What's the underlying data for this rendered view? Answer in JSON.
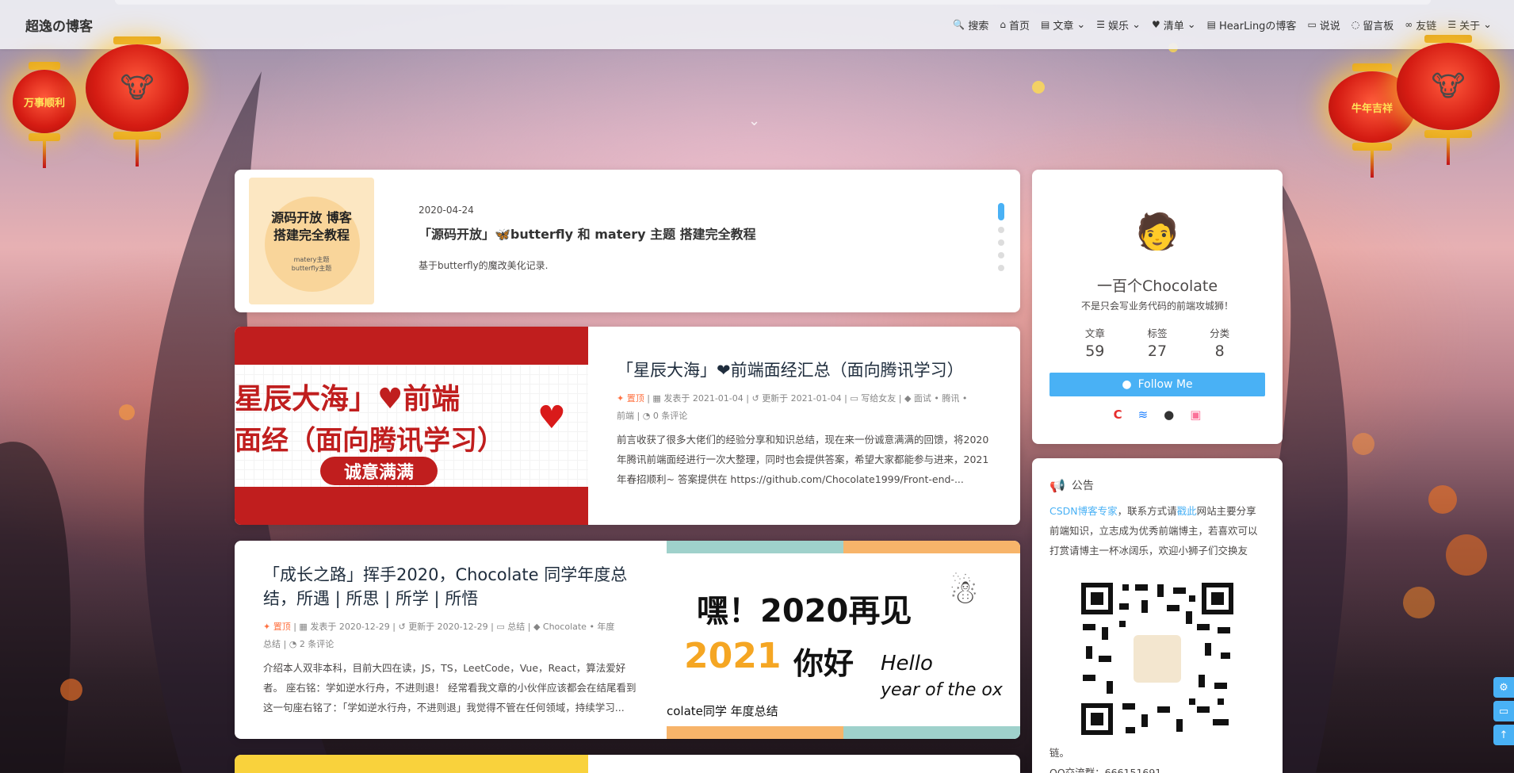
{
  "nav": {
    "brand": "超逸の博客",
    "items": [
      {
        "label": "搜索",
        "icon": "search-icon",
        "glyph": "🔍",
        "caret": false
      },
      {
        "label": "首页",
        "icon": "home-icon",
        "glyph": "⌂",
        "caret": false
      },
      {
        "label": "文章",
        "icon": "book-icon",
        "glyph": "▤",
        "caret": true
      },
      {
        "label": "娱乐",
        "icon": "list-icon",
        "glyph": "☰",
        "caret": true
      },
      {
        "label": "清单",
        "icon": "heart-icon",
        "glyph": "♥",
        "caret": true
      },
      {
        "label": "HearLingの博客",
        "icon": "book-icon",
        "glyph": "▤",
        "caret": false
      },
      {
        "label": "说说",
        "icon": "comment-icon",
        "glyph": "▭",
        "caret": false
      },
      {
        "label": "留言板",
        "icon": "message-icon",
        "glyph": "◌",
        "caret": false
      },
      {
        "label": "友链",
        "icon": "link-icon",
        "glyph": "∞",
        "caret": false
      },
      {
        "label": "关于",
        "icon": "list-icon",
        "glyph": "☰",
        "caret": true
      }
    ]
  },
  "lanterns": {
    "left": "万事顺利",
    "right": "牛年吉祥"
  },
  "slider": {
    "date": "2020-04-24",
    "title": "「源码开放」🦋butterfly 和 matery 主题 搭建完全教程",
    "desc": "基于butterfly的魔改美化记录.",
    "cover_line1": "源码开放 博客",
    "cover_line2": "搭建完全教程",
    "cover_sub1": "matery主题",
    "cover_sub2": "butterfly主题"
  },
  "posts": [
    {
      "title": "「星辰大海」❤前端面经汇总（面向腾讯学习）",
      "sticky": "置顶",
      "published": "发表于 2021-01-04",
      "updated": "更新于 2021-01-04",
      "category": "写给女友",
      "tags": "面试 • 腾讯 •",
      "tags2": "前端",
      "comments": "0 条评论",
      "excerpt": "前言收获了很多大佬们的经验分享和知识总结，现在来一份诚意满满的回馈，将2020年腾讯前端面经进行一次大整理，同时也会提供答案，希望大家都能参与进来，2021年春招顺利~ 答案提供在 https://github.com/Chocolate1999/Front-end-...",
      "cover_line1": "星辰大海」♥前端",
      "cover_line2": "面经（面向腾讯学习）",
      "cover_badge": "诚意满满"
    },
    {
      "title": "「成长之路」挥手2020，Chocolate 同学年度总结，所遇 | 所思 | 所学 | 所悟",
      "sticky": "置顶",
      "published": "发表于 2020-12-29",
      "updated": "更新于 2020-12-29",
      "category": "总结",
      "tags": "Chocolate • 年度",
      "tags2": "总结",
      "comments": "2 条评论",
      "excerpt": "介绍本人双非本科，目前大四在读，JS，TS，LeetCode，Vue，React，算法爱好者。 座右铭：学如逆水行舟，不进则退！ 经常看我文章的小伙伴应该都会在结尾看到这一句座右铭了：「学如逆水行舟，不进则退」我觉得不管在任何领域，持续学习...",
      "cover_line1": "嘿！2020再见",
      "cover_line2": "2021",
      "cover_line3": "你好",
      "cover_line4": "Hello",
      "cover_line5": "year of the ox",
      "cover_line6": "colate同学 年度总结"
    }
  ],
  "profile": {
    "name": "一百个Chocolate",
    "bio": "不是只会写业务代码的前端攻城狮！",
    "stats": [
      {
        "label": "文章",
        "value": "59"
      },
      {
        "label": "标签",
        "value": "27"
      },
      {
        "label": "分类",
        "value": "8"
      }
    ],
    "follow": "Follow Me"
  },
  "announcement": {
    "title": "公告",
    "link1": "CSDN博客专家",
    "text1": "，联系方式请",
    "link2": "戳此",
    "text2": "网站主要分享前端知识，立志成为优秀前端博主，若喜欢可以打赏请博主一杯冰阔乐，欢迎小狮子们交换友",
    "tail": "链。",
    "qq": "QQ交流群：666151691"
  },
  "colors": {
    "accent": "#49b1f5",
    "sticky": "#ff7242"
  }
}
